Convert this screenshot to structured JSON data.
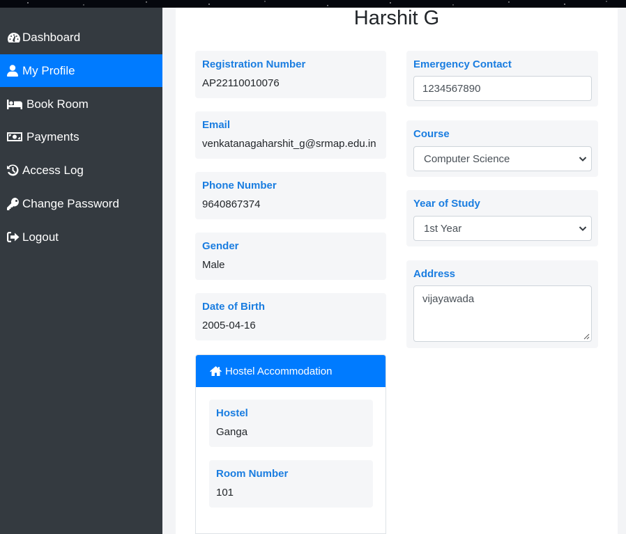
{
  "sidebar": {
    "items": [
      {
        "label": "Dashboard",
        "icon": "tachometer-icon",
        "active": false
      },
      {
        "label": "My Profile",
        "icon": "user-icon",
        "active": true
      },
      {
        "label": "Book Room",
        "icon": "bed-icon",
        "active": false
      },
      {
        "label": "Payments",
        "icon": "money-bill-icon",
        "active": false
      },
      {
        "label": "Access Log",
        "icon": "history-icon",
        "active": false
      },
      {
        "label": "Change Password",
        "icon": "key-icon",
        "active": false
      },
      {
        "label": "Logout",
        "icon": "sign-out-icon",
        "active": false
      }
    ]
  },
  "profile": {
    "name": "Harshit G",
    "registration_label": "Registration Number",
    "registration_value": "AP22110010076",
    "email_label": "Email",
    "email_value": "venkatanagaharshit_g@srmap.edu.in",
    "phone_label": "Phone Number",
    "phone_value": "9640867374",
    "gender_label": "Gender",
    "gender_value": "Male",
    "dob_label": "Date of Birth",
    "dob_value": "2005-04-16",
    "emergency_label": "Emergency Contact",
    "emergency_value": "1234567890",
    "course_label": "Course",
    "course_value": "Computer Science",
    "year_label": "Year of Study",
    "year_value": "1st Year",
    "address_label": "Address",
    "address_value": "vijayawada"
  },
  "hostel": {
    "header": "Hostel Accommodation",
    "hostel_label": "Hostel",
    "hostel_value": "Ganga",
    "room_label": "Room Number",
    "room_value": "101"
  },
  "colors": {
    "accent": "#007bff",
    "label": "#1a7de0",
    "sidebar_bg": "#343a40"
  }
}
